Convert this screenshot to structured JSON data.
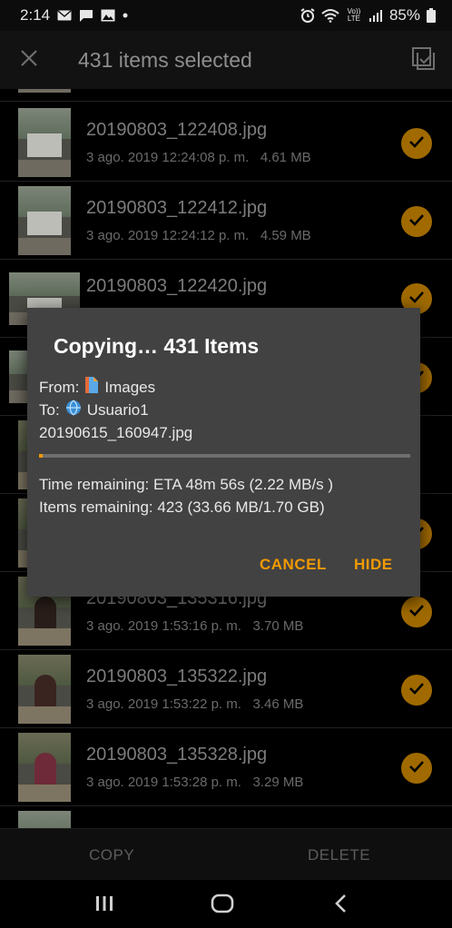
{
  "status_bar": {
    "time": "2:14",
    "battery": "85%",
    "signal_badge": "Vo)) LTE"
  },
  "action_bar": {
    "title": "431 items selected"
  },
  "files": [
    {
      "name": "20190803_122408.jpg",
      "date": "3 ago. 2019 12:24:08 p. m.",
      "size": "4.61 MB",
      "thumb": "house"
    },
    {
      "name": "20190803_122412.jpg",
      "date": "3 ago. 2019 12:24:12 p. m.",
      "size": "4.59 MB",
      "thumb": "house"
    },
    {
      "name": "20190803_122420.jpg",
      "date": "",
      "size": "",
      "thumb": "house"
    },
    {
      "name": "20190803_135316.jpg",
      "date": "3 ago. 2019 1:53:16 p. m.",
      "size": "3.70 MB",
      "thumb": "person"
    },
    {
      "name": "20190803_135322.jpg",
      "date": "3 ago. 2019 1:53:22 p. m.",
      "size": "3.46 MB",
      "thumb": "person"
    },
    {
      "name": "20190803_135328.jpg",
      "date": "3 ago. 2019 1:53:28 p. m.",
      "size": "3.29 MB",
      "thumb": "person"
    }
  ],
  "dialog": {
    "title": "Copying… 431 Items",
    "from_label": "From:",
    "from_value": "Images",
    "to_label": "To:",
    "to_value": "Usuario1",
    "current_file": "20190615_160947.jpg",
    "progress": 0.01,
    "time_remaining": "Time remaining: ETA 48m 56s (2.22 MB/s )",
    "items_remaining": "Items remaining: 423 (33.66 MB/1.70 GB)",
    "cancel_label": "CANCEL",
    "hide_label": "HIDE"
  },
  "bottom_bar": {
    "copy_label": "COPY",
    "delete_label": "DELETE"
  },
  "colors": {
    "accent": "#f29a00",
    "check": "#a06a00",
    "dialog_bg": "#424242"
  },
  "icons": [
    "envelope-icon",
    "chat-icon",
    "image-icon",
    "alarm-icon",
    "wifi-icon",
    "signal-icon",
    "battery-icon",
    "close-icon",
    "select-all-icon",
    "check-icon",
    "file-icon",
    "globe-icon",
    "recents-icon",
    "home-icon",
    "back-icon"
  ]
}
